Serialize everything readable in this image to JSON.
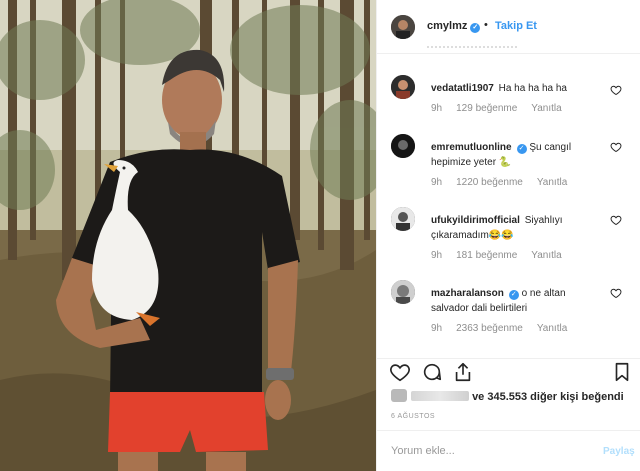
{
  "post": {
    "username": "cmylmz",
    "follow_label": "Takip Et",
    "dot": "•",
    "verified_glyph": "✓"
  },
  "comments": [
    {
      "user": "vedatatli1907",
      "text": "Ha ha ha ha ha",
      "time": "9h",
      "likes": "129 beğenme",
      "reply": "Yanıtla",
      "verified": false
    },
    {
      "user": "emremutluonline",
      "text": "Şu cangıl hepimize yeter 🐍",
      "time": "9h",
      "likes": "1220 beğenme",
      "reply": "Yanıtla",
      "verified": true
    },
    {
      "user": "ufukyildirimofficial",
      "text": "Siyahlıyı çıkaramadım😂😂",
      "time": "9h",
      "likes": "181 beğenme",
      "reply": "Yanıtla",
      "verified": false
    },
    {
      "user": "mazharalanson",
      "text": "o ne altan salvador dali belirtileri",
      "time": "9h",
      "likes": "2363 beğenme",
      "reply": "Yanıtla",
      "verified": true
    }
  ],
  "likes": {
    "text": "ve 345.553 diğer kişi beğendi"
  },
  "date": "6 AĞUSTOS",
  "add_comment": {
    "placeholder": "Yorum ekle...",
    "post_label": "Paylaş"
  },
  "icons": {
    "like": "heart-icon",
    "comment": "comment-icon",
    "share": "share-icon",
    "save": "bookmark-icon",
    "comment_like": "heart-icon"
  },
  "colors": {
    "accent": "#3897f0",
    "muted": "#8e8e8e",
    "border": "#efefef"
  }
}
